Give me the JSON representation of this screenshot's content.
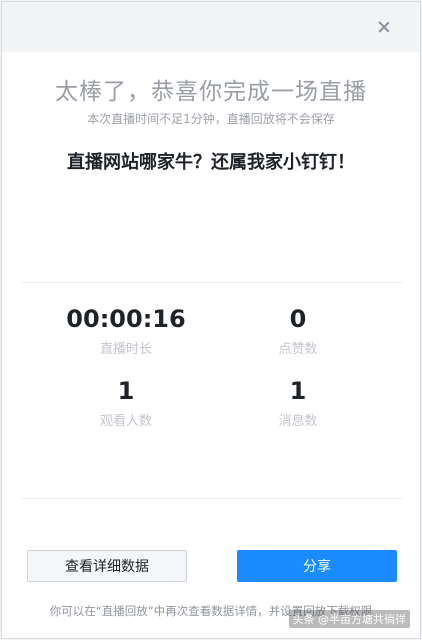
{
  "dialog": {
    "headline": "太棒了，恭喜你完成一场直播",
    "subline": "本次直播时间不足1分钟，直播回放将不会保存",
    "slogan": "直播网站哪家牛？还属我家小钉钉！"
  },
  "stats": {
    "duration": {
      "value": "00:00:16",
      "label": "直播时长"
    },
    "likes": {
      "value": "0",
      "label": "点赞数"
    },
    "viewers": {
      "value": "1",
      "label": "观看人数"
    },
    "messages": {
      "value": "1",
      "label": "消息数"
    }
  },
  "buttons": {
    "detail_label": "查看详细数据",
    "share_label": "分享"
  },
  "footer": "你可以在“直播回放”中再次查看数据详情，并设置回放下载权限",
  "watermark": "头条 @半亩方塘共徜徉",
  "colors": {
    "accent": "#1a8cff",
    "muted_text": "#9ea2a9"
  }
}
